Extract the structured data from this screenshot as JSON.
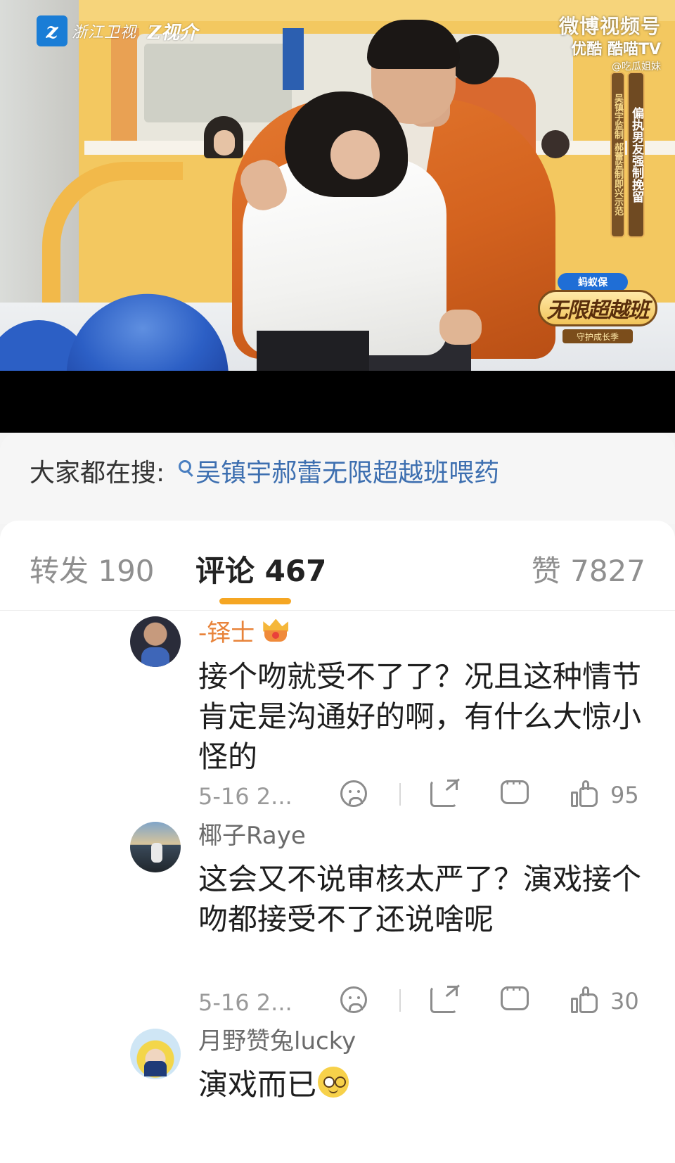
{
  "video": {
    "channel_logo_text": "浙江卫视",
    "channel_logo_text2": "Z视介",
    "watermark_top": "微博视频号",
    "watermark_mid": "优酷  酷喵TV",
    "watermark_handle": "@吃瓜姐妹",
    "caption_main": "偏执男友强制挽留",
    "caption_sub": "吴镇宇监制 郝蕾监制即兴示范",
    "show_sponsor": "蚂蚁保",
    "show_title": "无限超越班",
    "show_subtitle": "守护成长季"
  },
  "search": {
    "label": "大家都在搜:",
    "query": "吴镇宇郝蕾无限超越班喂药"
  },
  "tabs": {
    "repost": "转发 190",
    "comment": "评论 467",
    "like": "赞 7827"
  },
  "comments": [
    {
      "name": "-铎士",
      "text": "接个吻就受不了了？况且这种情节肯定是沟通好的啊，有什么大惊小怪的",
      "time": "5-16 2...",
      "likes": "95"
    },
    {
      "name": "椰子Raye",
      "text": "这会又不说审核太严了？演戏接个吻都接受不了还说啥呢",
      "time": "5-16 2...",
      "likes": "30"
    },
    {
      "name": "月野赞兔lucky",
      "text": "演戏而已"
    }
  ],
  "colors": {
    "accent_orange": "#f5a623",
    "name_orange": "#e8833a",
    "link_blue": "#3d6fb0"
  }
}
